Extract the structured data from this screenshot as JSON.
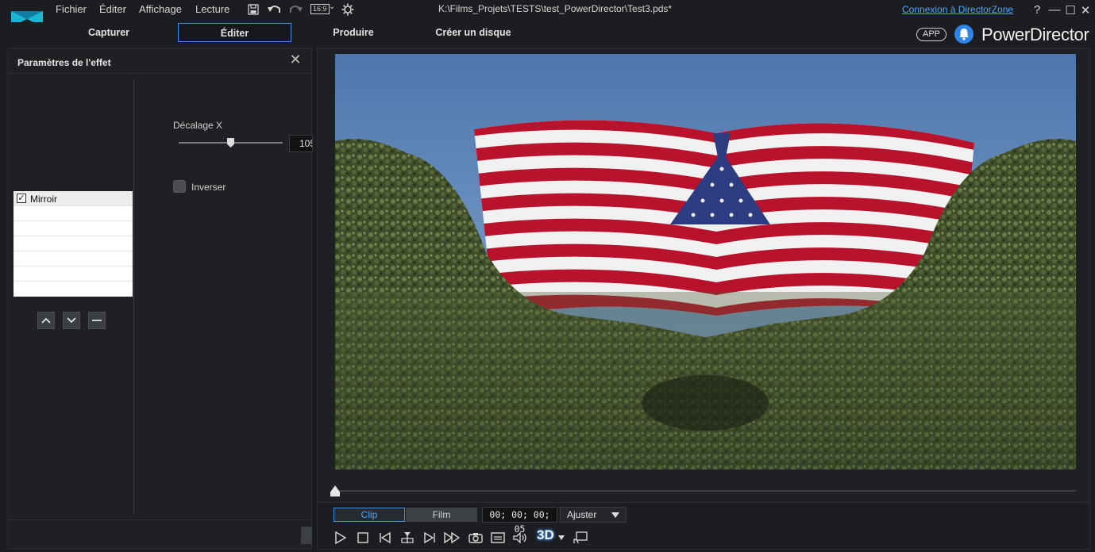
{
  "menu": {
    "fichier": "Fichier",
    "editer": "Éditer",
    "affichage": "Affichage",
    "lecture": "Lecture",
    "aspect_ratio": "16:9"
  },
  "window": {
    "file_path": "K:\\Films_Projets\\TESTS\\test_PowerDirector\\Test3.pds*",
    "directorzone_link": "Connexion à DirectorZone",
    "help": "?",
    "minimize": "—",
    "maximize": "☐",
    "close": "✕"
  },
  "modes": {
    "capturer": "Capturer",
    "editer": "Éditer",
    "produire": "Produire",
    "creer_disque": "Créer un disque"
  },
  "brand": {
    "app_badge": "APP",
    "name": "PowerDirector"
  },
  "effect_panel": {
    "title": "Paramètres de l'effet",
    "effects": [
      {
        "label": "Mirroir",
        "checked": true
      }
    ],
    "offset_label": "Décalage X",
    "offset_value": "105",
    "offset_fraction": 0.5,
    "invert_label": "Inverser"
  },
  "preview": {
    "clip_tab": "Clip",
    "film_tab": "Film",
    "timecode": "00; 00; 00; 05",
    "zoom": "Ajuster",
    "three_d": "3D"
  },
  "colors": {
    "accent": "#3a8ee6",
    "link": "#4ea8ff",
    "background": "#1a1c1f"
  }
}
